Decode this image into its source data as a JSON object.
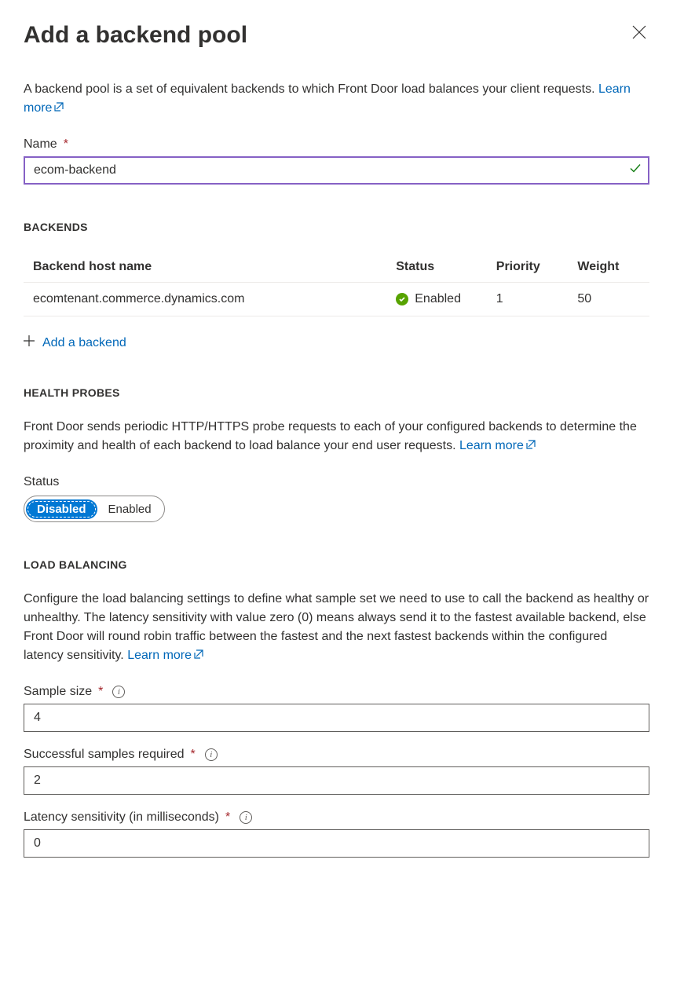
{
  "header": {
    "title": "Add a backend pool"
  },
  "intro": {
    "text": "A backend pool is a set of equivalent backends to which Front Door load balances your client requests. ",
    "learn_more": "Learn more"
  },
  "name_field": {
    "label": "Name",
    "value": "ecom-backend"
  },
  "backends": {
    "section_title": "BACKENDS",
    "columns": {
      "host": "Backend host name",
      "status": "Status",
      "priority": "Priority",
      "weight": "Weight"
    },
    "rows": [
      {
        "host": "ecomtenant.commerce.dynamics.com",
        "status": "Enabled",
        "priority": "1",
        "weight": "50"
      }
    ],
    "add_label": "Add a backend"
  },
  "health": {
    "section_title": "HEALTH PROBES",
    "desc": "Front Door sends periodic HTTP/HTTPS probe requests to each of your configured backends to determine the proximity and health of each backend to load balance your end user requests. ",
    "learn_more": "Learn more",
    "status_label": "Status",
    "toggle": {
      "disabled": "Disabled",
      "enabled": "Enabled"
    }
  },
  "lb": {
    "section_title": "LOAD BALANCING",
    "desc": "Configure the load balancing settings to define what sample set we need to use to call the backend as healthy or unhealthy. The latency sensitivity with value zero (0) means always send it to the fastest available backend, else Front Door will round robin traffic between the fastest and the next fastest backends within the configured latency sensitivity. ",
    "learn_more": "Learn more",
    "sample_size": {
      "label": "Sample size",
      "value": "4"
    },
    "successful": {
      "label": "Successful samples required",
      "value": "2"
    },
    "latency": {
      "label": "Latency sensitivity (in milliseconds)",
      "value": "0"
    }
  }
}
